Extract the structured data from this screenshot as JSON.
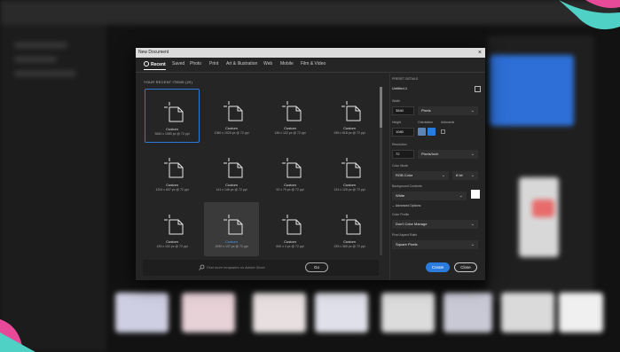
{
  "dialog": {
    "title": "New Document",
    "close_glyph": "×"
  },
  "tabs": [
    {
      "label": "Recent",
      "active": true
    },
    {
      "label": "Saved"
    },
    {
      "label": "Photo"
    },
    {
      "label": "Print"
    },
    {
      "label": "Art & Illustration"
    },
    {
      "label": "Web"
    },
    {
      "label": "Mobile"
    },
    {
      "label": "Film & Video"
    }
  ],
  "recent": {
    "heading": "YOUR RECENT ITEMS (20)",
    "items": [
      {
        "name": "Custom",
        "dims": "3840 x 1080 px @ 72 ppi",
        "selected": true
      },
      {
        "name": "Custom",
        "dims": "1080 x 1920 px @ 72 ppi"
      },
      {
        "name": "Custom",
        "dims": "136 x 102 px @ 72 ppi"
      },
      {
        "name": "Custom",
        "dims": "939 x 618 px @ 72 ppi"
      },
      {
        "name": "Custom",
        "dims": "1204 x 607 px @ 72 ppi"
      },
      {
        "name": "Custom",
        "dims": "141 x 146 px @ 72 ppi"
      },
      {
        "name": "Custom",
        "dims": "92 x 79 px @ 72 ppi"
      },
      {
        "name": "Custom",
        "dims": "124 x 125 px @ 72 ppi"
      },
      {
        "name": "Custom",
        "dims": "133 x 102 px @ 72 ppi"
      },
      {
        "name": "Custom",
        "dims": "1090 x 137 px @ 72 ppi",
        "hover": true
      },
      {
        "name": "Custom",
        "dims": "840 x 4 px @ 72 ppi"
      },
      {
        "name": "Custom",
        "dims": "233 x 360 px @ 72 ppi"
      }
    ]
  },
  "search": {
    "placeholder": "Find more templates on Adobe Stock",
    "go_label": "Go"
  },
  "preset": {
    "section_label": "PRESET DETAILS",
    "name": "Untitled-1",
    "width_label": "Width",
    "width_value": "3840",
    "width_unit": "Pixels",
    "height_label": "Height",
    "height_value": "1080",
    "orientation_label": "Orientation",
    "artboards_label": "Artboards",
    "resolution_label": "Resolution",
    "resolution_value": "72",
    "resolution_unit": "Pixels/Inch",
    "color_mode_label": "Color Mode",
    "color_mode_value": "RGB Color",
    "bit_depth": "8 bit",
    "bg_contents_label": "Background Contents",
    "bg_contents_value": "White",
    "advanced_label": "Advanced Options",
    "color_profile_label": "Color Profile",
    "color_profile_value": "Don't Color Manage",
    "pixel_aspect_label": "Pixel Aspect Ratio",
    "pixel_aspect_value": "Square Pixels"
  },
  "buttons": {
    "create": "Create",
    "close": "Close"
  },
  "colors": {
    "accent": "#2a7bdc",
    "dialog_bg": "#252525",
    "corner_teal": "#4fd1c5",
    "corner_pink": "#e84a9a"
  }
}
